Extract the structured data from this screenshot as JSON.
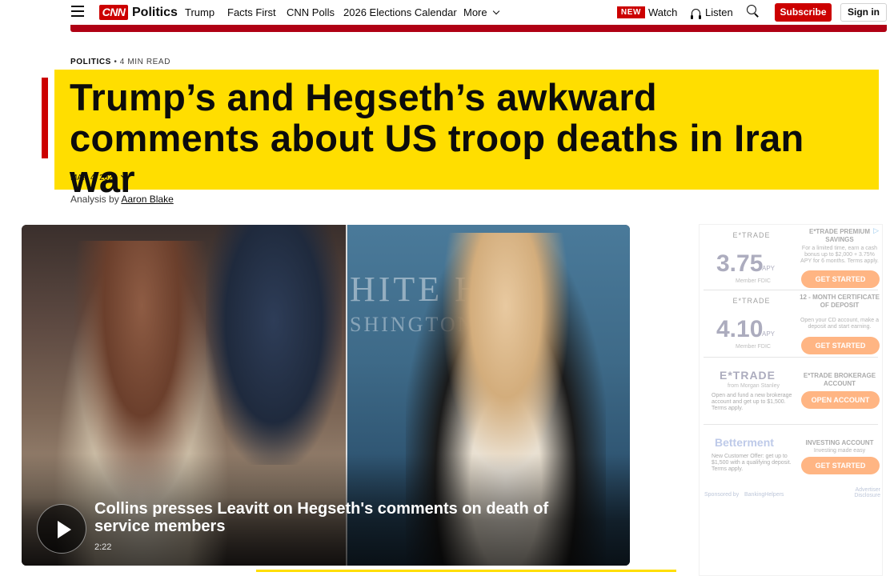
{
  "header": {
    "logo": "CNN",
    "section": "Politics",
    "nav": [
      "Trump",
      "Facts First",
      "CNN Polls",
      "2026 Elections Calendar",
      "More"
    ],
    "new_badge": "NEW",
    "watch": "Watch",
    "listen": "Listen",
    "subscribe": "Subscribe",
    "signin": "Sign in"
  },
  "article": {
    "section": "POLITICS",
    "read_time": "4 MIN READ",
    "headline": "Trump’s and Hegseth’s awkward comments about US troop deaths in Iran war",
    "date": "MAR 4, 2026",
    "byline_prefix": "Analysis by",
    "author": "Aaron Blake"
  },
  "video": {
    "title": "Collins presses Leavitt on Hegseth's comments on death of service members",
    "duration": "2:22",
    "backdrop_text_1": "HITE H",
    "backdrop_text_2": "SHINGTON"
  },
  "ad": {
    "brand_1": "E*TRADE",
    "rate_1": "3.75",
    "apy": "APY",
    "member_fdic": "Member FDIC",
    "head_1": "E*TRADE PREMIUM SAVINGS",
    "body_1": "For a limited time, earn a cash bonus up to $2,000 + 3.75% APY for 6 months. Terms apply.",
    "cta_1": "GET STARTED",
    "rate_2": "4.10",
    "head_2": "12 - MONTH CERTIFICATE OF DEPOSIT",
    "body_2": "Open your CD account, make a deposit and start earning.",
    "cta_2": "GET STARTED",
    "brand_3": "E*TRADE",
    "brand_3_sub": "from Morgan Stanley",
    "body_3_left": "Open and fund a new brokerage account and get up to $1,500. Terms apply.",
    "head_3": "E*TRADE BROKERAGE ACCOUNT",
    "cta_3": "OPEN ACCOUNT",
    "brand_4": "Betterment",
    "body_4_left": "New Customer Offer: get up to $1,500 with a qualifying deposit. Terms apply.",
    "head_4": "INVESTING ACCOUNT",
    "body_4": "Investing made easy",
    "cta_4": "GET STARTED",
    "sponsored": "Sponsored by",
    "sponsor": "BankingHelpers",
    "disclosure": "Advertiser Disclosure"
  },
  "colors": {
    "brand_red": "#cc0000",
    "headline_yellow": "#ffde00"
  }
}
